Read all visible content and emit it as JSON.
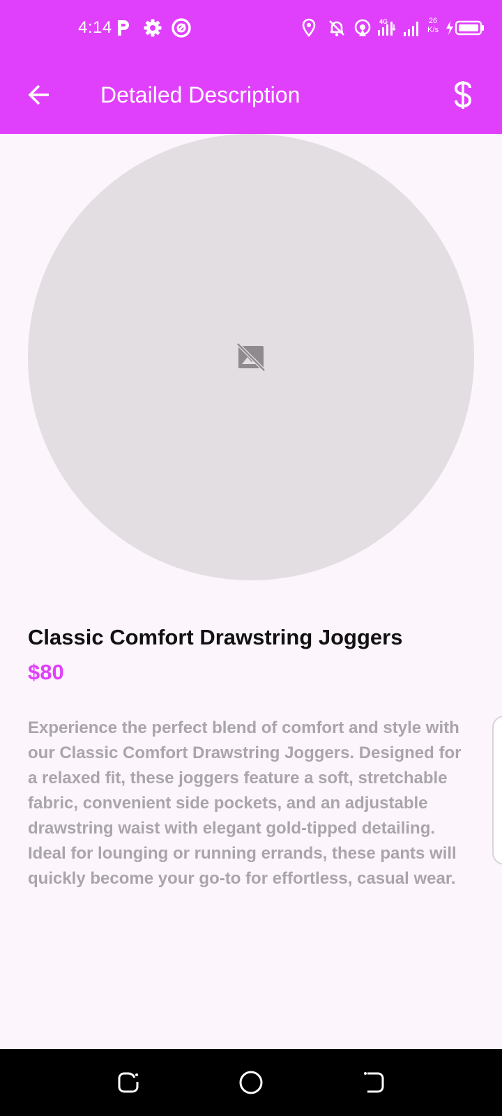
{
  "status_bar": {
    "time": "4:14",
    "network_speed_value": "26",
    "network_speed_unit": "K/s",
    "network_type": "4G",
    "battery_level": 0.85
  },
  "header": {
    "title": "Detailed Description",
    "back_icon": "arrow-back-icon",
    "action_icon": "dollar-icon"
  },
  "product": {
    "image_icon": "image-not-supported-icon",
    "name": "Classic Comfort Drawstring Joggers",
    "price": "$80",
    "description": "Experience the perfect blend of comfort and style with our Classic Comfort Drawstring Joggers. Designed for a relaxed fit, these joggers feature a soft, stretchable fabric, convenient side pockets, and an adjustable drawstring waist with elegant gold-tipped detailing. Ideal for lounging or running errands, these pants will quickly become your go-to for effortless, casual wear."
  },
  "colors": {
    "app_bar": "#e040fb",
    "background": "#fcf5fc",
    "price": "#e040fb",
    "description_text": "#a9a5a9",
    "image_placeholder": "#e2dee2"
  },
  "nav_bar": {
    "recents_icon": "recents-icon",
    "home_icon": "home-circle-icon",
    "back_icon": "nav-back-icon"
  }
}
